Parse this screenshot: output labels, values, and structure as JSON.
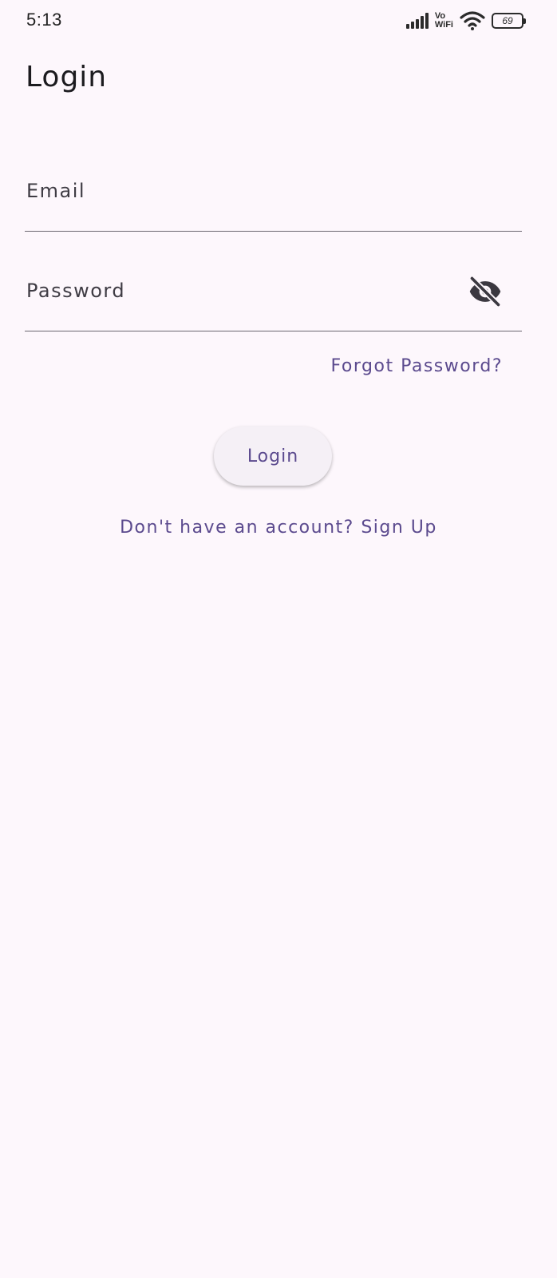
{
  "status_bar": {
    "time": "5:13",
    "network_label_top": "Vo",
    "network_label_bottom": "WiFi",
    "battery_level": "69",
    "icons": [
      "signal-icon",
      "vowifi-icon",
      "wifi-icon",
      "battery-icon"
    ]
  },
  "header": {
    "title": "Login"
  },
  "form": {
    "email": {
      "placeholder": "Email",
      "value": ""
    },
    "password": {
      "placeholder": "Password",
      "value": "",
      "toggle_icon": "eye-off-icon"
    },
    "forgot_password_label": "Forgot Password?",
    "login_label": "Login",
    "signup_label": "Don't have an account? Sign Up"
  },
  "colors": {
    "background": "#fdf7fc",
    "accent": "#5b4a8e",
    "button_bg": "#f5f0f6",
    "divider": "#6b6770"
  }
}
